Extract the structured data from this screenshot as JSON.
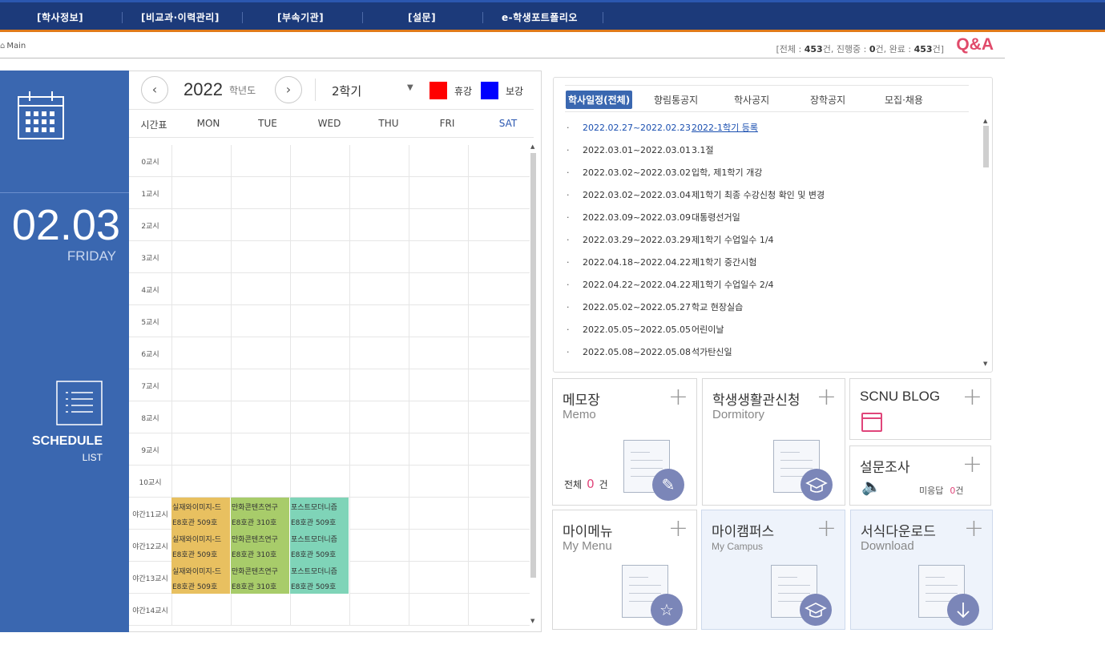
{
  "topnav": {
    "items": [
      "[학사정보]",
      "[비교과·이력관리]",
      "[부속기관]",
      "[설문]",
      "e-학생포트폴리오"
    ]
  },
  "breadcrumb": {
    "home": "Main"
  },
  "qa": {
    "prefix": "[전체 : ",
    "total": "453",
    "mid1": "건, 진행중 : ",
    "progress": "0",
    "mid2": "건, 완료 : ",
    "done": "453",
    "suffix": "건]",
    "label": "Q&A"
  },
  "left": {
    "date": "02.03",
    "day": "FRIDAY",
    "schedule": "SCHEDULE",
    "list": "LIST"
  },
  "timetable": {
    "year": "2022",
    "year_label": "학년도",
    "semester": "2학기",
    "legend": [
      {
        "label": "휴강",
        "color": "#ff0000"
      },
      {
        "label": "보강",
        "color": "#0000ff"
      }
    ],
    "header": [
      "시간표",
      "MON",
      "TUE",
      "WED",
      "THU",
      "FRI",
      "SAT"
    ],
    "rows": [
      "0교시",
      "1교시",
      "2교시",
      "3교시",
      "4교시",
      "5교시",
      "6교시",
      "7교시",
      "8교시",
      "9교시",
      "10교시",
      "야간11교시",
      "야간12교시",
      "야간13교시",
      "야간14교시"
    ],
    "classes": [
      {
        "row": 11,
        "col": 0,
        "name": "실재와이미지-드",
        "room": "E8호관 509호",
        "color": "#e8c060"
      },
      {
        "row": 11,
        "col": 1,
        "name": "만화콘텐츠연구",
        "room": "E8호관 310호",
        "color": "#a8cc6a"
      },
      {
        "row": 11,
        "col": 2,
        "name": "포스트모더니즘",
        "room": "E8호관 509호",
        "color": "#7fd4b8"
      },
      {
        "row": 12,
        "col": 0,
        "name": "실재와이미지-드",
        "room": "E8호관 509호",
        "color": "#e8c060"
      },
      {
        "row": 12,
        "col": 1,
        "name": "만화콘텐츠연구",
        "room": "E8호관 310호",
        "color": "#a8cc6a"
      },
      {
        "row": 12,
        "col": 2,
        "name": "포스트모더니즘",
        "room": "E8호관 509호",
        "color": "#7fd4b8"
      },
      {
        "row": 13,
        "col": 0,
        "name": "실재와이미지-드",
        "room": "E8호관 509호",
        "color": "#e8c060"
      },
      {
        "row": 13,
        "col": 1,
        "name": "만화콘텐츠연구",
        "room": "E8호관 310호",
        "color": "#a8cc6a"
      },
      {
        "row": 13,
        "col": 2,
        "name": "포스트모더니즘",
        "room": "E8호관 509호",
        "color": "#7fd4b8"
      }
    ]
  },
  "notice": {
    "tabs": [
      "학사일정(전체)",
      "향림통공지",
      "학사공지",
      "장학공지",
      "모집·채용"
    ],
    "items": [
      {
        "start": "2022.02.27~",
        "end": "2022.02.23",
        "title": "2022-1학기 등록",
        "link": true
      },
      {
        "start": "2022.03.01~",
        "end": "2022.03.01",
        "title": "3.1절"
      },
      {
        "start": "2022.03.02~",
        "end": "2022.03.02",
        "title": "입학, 제1학기 개강"
      },
      {
        "start": "2022.03.02~",
        "end": "2022.03.04",
        "title": "제1학기 최종 수강신청 확인 및 변경"
      },
      {
        "start": "2022.03.09~",
        "end": "2022.03.09",
        "title": "대통령선거일"
      },
      {
        "start": "2022.03.29~",
        "end": "2022.03.29",
        "title": "제1학기 수업일수 1/4"
      },
      {
        "start": "2022.04.18~",
        "end": "2022.04.22",
        "title": "제1학기 중간시험"
      },
      {
        "start": "2022.04.22~",
        "end": "2022.04.22",
        "title": "제1학기 수업일수 2/4"
      },
      {
        "start": "2022.05.02~",
        "end": "2022.05.27",
        "title": "학교 현장실습"
      },
      {
        "start": "2022.05.05~",
        "end": "2022.05.05",
        "title": "어린이날"
      },
      {
        "start": "2022.05.08~",
        "end": "2022.05.08",
        "title": "석가탄신일"
      }
    ]
  },
  "cards": {
    "memo": {
      "title": "메모장",
      "sub": "Memo",
      "count_label": "전체",
      "count": "0",
      "unit": "건",
      "icon": "pencil-icon"
    },
    "dorm": {
      "title": "학생생활관신청",
      "sub": "Dormitory",
      "icon": "graduation-cap-icon"
    },
    "blog": {
      "title": "SCNU BLOG",
      "icon": "browser-window-icon"
    },
    "survey": {
      "title": "설문조사",
      "status": "미응답",
      "count": "0",
      "unit": "건",
      "icon": "speaker-icon"
    },
    "mymenu": {
      "title": "마이메뉴",
      "sub": "My Menu",
      "icon": "star-icon"
    },
    "campus": {
      "title": "마이캠퍼스",
      "sub": "My Campus",
      "icon": "graduation-cap-icon"
    },
    "download": {
      "title": "서식다운로드",
      "sub": "Download",
      "icon": "download-arrow-icon"
    },
    "plus": "+"
  }
}
